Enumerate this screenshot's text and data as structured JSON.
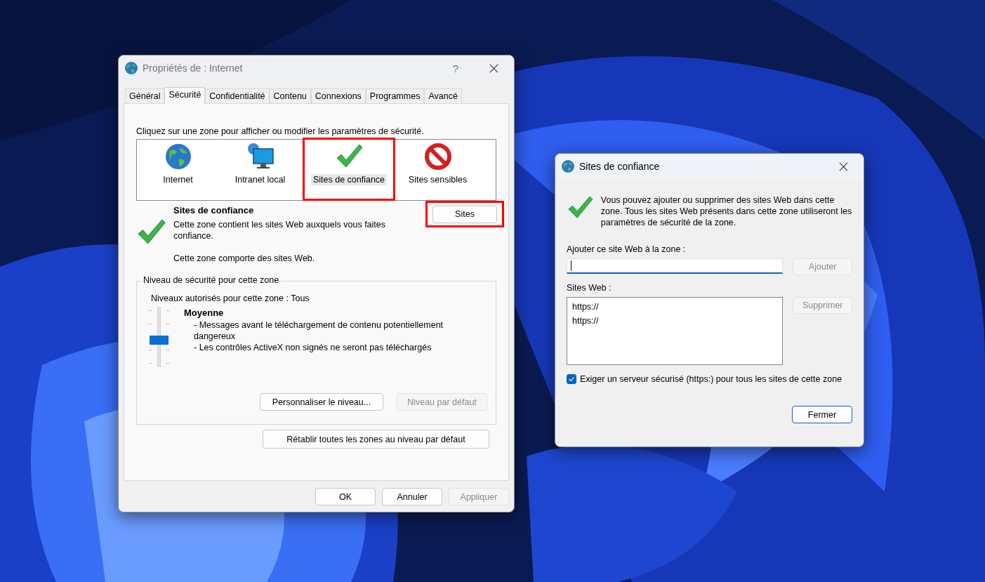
{
  "main_window": {
    "title": "Propriétés de : Internet",
    "help_button": "?",
    "tabs": [
      {
        "label": "Général",
        "selected": false
      },
      {
        "label": "Sécurité",
        "selected": true
      },
      {
        "label": "Confidentialité",
        "selected": false
      },
      {
        "label": "Contenu",
        "selected": false
      },
      {
        "label": "Connexions",
        "selected": false
      },
      {
        "label": "Programmes",
        "selected": false
      },
      {
        "label": "Avancé",
        "selected": false
      }
    ],
    "instruction": "Cliquez sur une zone pour afficher ou modifier les paramètres de sécurité.",
    "zones": [
      {
        "label": "Internet",
        "kind": "globe",
        "selected": false,
        "highlighted": false
      },
      {
        "label": "Intranet local",
        "kind": "monitor",
        "selected": false,
        "highlighted": false
      },
      {
        "label": "Sites de confiance",
        "kind": "check",
        "selected": true,
        "highlighted": true
      },
      {
        "label": "Sites sensibles",
        "kind": "forbidden",
        "selected": false,
        "highlighted": false
      }
    ],
    "zone_info": {
      "title": "Sites de confiance",
      "description": "Cette zone contient les sites Web auxquels vous faites confiance.",
      "note": "Cette zone comporte des sites Web."
    },
    "sites_button": {
      "label": "Sites",
      "highlighted": true
    },
    "security_level": {
      "legend": "Niveau de sécurité pour cette zone",
      "allowed": "Niveaux autorisés pour cette zone : Tous",
      "level": 0.5,
      "name": "Moyenne",
      "bullets": [
        "- Messages avant le téléchargement de contenu potentiellement dangereux",
        "- Les contrôles ActiveX non signés ne seront pas téléchargés"
      ],
      "buttons": [
        {
          "label": "Personnaliser le niveau...",
          "disabled": false
        },
        {
          "label": "Niveau par défaut",
          "disabled": true
        }
      ]
    },
    "reset_button": "Rétablir toutes les zones au niveau par défaut",
    "footer_buttons": [
      {
        "label": "OK",
        "disabled": false
      },
      {
        "label": "Annuler",
        "disabled": false
      },
      {
        "label": "Appliquer",
        "disabled": true
      }
    ]
  },
  "sites_dialog": {
    "title": "Sites de confiance",
    "description": "Vous pouvez ajouter ou supprimer des sites Web dans cette zone. Tous les sites Web présents dans cette zone utiliseront les paramètres de sécurité de la zone.",
    "add_label": "Ajouter ce site Web à la zone :",
    "add_field": {
      "focused": true
    },
    "add_button": {
      "label": "Ajouter",
      "disabled": true
    },
    "list_label": "Sites Web :",
    "websites": [
      "https://",
      "https://"
    ],
    "remove_button": {
      "label": "Supprimer",
      "disabled": true
    },
    "require_https": {
      "label": "Exiger un serveur sécurisé (https:) pour tous les sites de cette zone",
      "checked": true
    },
    "close_button": "Fermer"
  }
}
